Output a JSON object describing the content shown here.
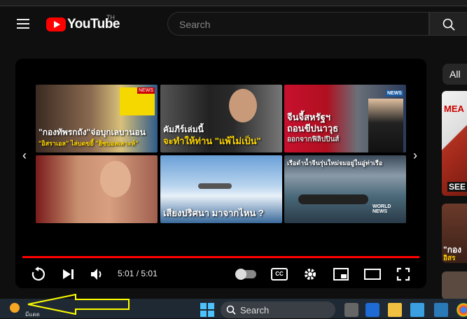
{
  "header": {
    "logo_text": "YouTube",
    "country_code": "TH",
    "search_placeholder": "Search"
  },
  "player": {
    "time_current": "5:01",
    "time_separator": "/",
    "time_total": "5:01",
    "progress": 1.0,
    "end_screen": [
      {
        "caption_line1": "\"กองทัพรกถัง\"จ่อบุกเลบานอน",
        "caption_line2": "\"อิสราเอล\" ไล่บดขยี้ \"ฮิซบอลเลาะห์\"",
        "badge": "NEWS"
      },
      {
        "caption_line1": "คัมภีร์เล่มนี้",
        "caption_line2": "จะทำให้ท่าน \"แพ้ไม่เป็น\"",
        "badge": ""
      },
      {
        "caption_line1": "จีนจี้สหรัฐฯ",
        "caption_line2": "ถอนขีปนาวุธ",
        "caption_line3": "ออกจากฟิลิปปินส์",
        "badge": "NEWS"
      },
      {
        "caption_line1": "",
        "caption_line2": "",
        "badge": ""
      },
      {
        "caption_line1": "เสียงปริศนา มาจากไหน ?",
        "caption_line2": "",
        "badge": ""
      },
      {
        "caption_line1": "เรือดำน้ำจีนรุ่นใหม่จมอยู่ในอู่ท่าเรือ",
        "caption_line2": "",
        "badge": "WORLD NEWS"
      }
    ]
  },
  "sidebar": {
    "chip_all": "All",
    "thumb1_text": "MEA",
    "thumb1_sub": "SEE",
    "thumb2_text": "\"กอง",
    "thumb2_sub": "อิสร"
  },
  "taskbar": {
    "search_label": "Search",
    "weather_text": "มีแดด"
  },
  "annotation": {
    "arrow_color": "#ffff00"
  }
}
